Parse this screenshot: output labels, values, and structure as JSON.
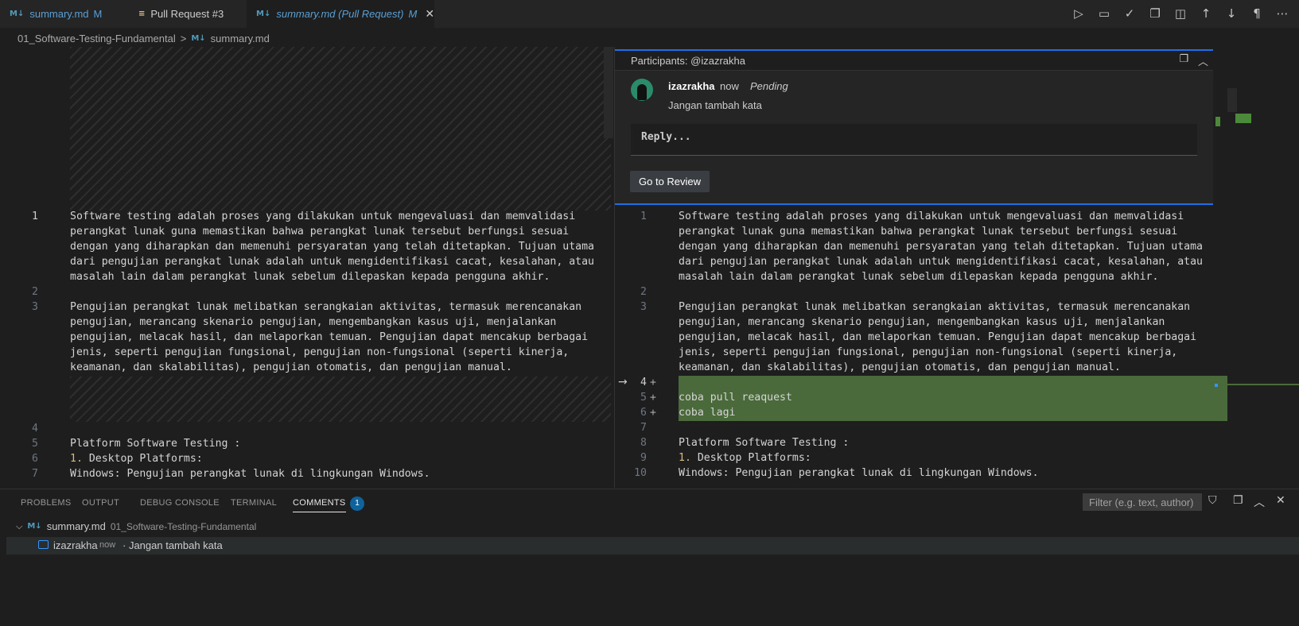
{
  "tabs": [
    {
      "label": "summary.md",
      "badge": "M",
      "icon": "markdown-icon"
    },
    {
      "label": "Pull Request #3",
      "badge": "",
      "icon": "pull-request-icon"
    },
    {
      "label": "summary.md (Pull Request)",
      "badge": "M",
      "icon": "markdown-icon",
      "close": "✕"
    }
  ],
  "editor_actions": [
    "run-icon",
    "comment-icon",
    "check-icon",
    "open-file-icon",
    "split-icon",
    "arrow-up-icon",
    "arrow-down-icon",
    "pilcrow-icon",
    "more-icon"
  ],
  "breadcrumb": {
    "folder": "01_Software-Testing-Fundamental",
    "separator": ">",
    "file": "summary.md"
  },
  "left": {
    "lines": [
      {
        "n": "1",
        "text": "Software testing adalah proses yang dilakukan untuk mengevaluasi dan memvalidasi"
      },
      {
        "n": "",
        "text": "perangkat lunak guna memastikan bahwa perangkat lunak tersebut berfungsi sesuai"
      },
      {
        "n": "",
        "text": "dengan yang diharapkan dan memenuhi persyaratan yang telah ditetapkan. Tujuan utama"
      },
      {
        "n": "",
        "text": "dari pengujian perangkat lunak adalah untuk mengidentifikasi cacat, kesalahan, atau"
      },
      {
        "n": "",
        "text": "masalah lain dalam perangkat lunak sebelum dilepaskan kepada pengguna akhir."
      },
      {
        "n": "2",
        "text": ""
      },
      {
        "n": "3",
        "text": "Pengujian perangkat lunak melibatkan serangkaian aktivitas, termasuk merencanakan"
      },
      {
        "n": "",
        "text": "pengujian, merancang skenario pengujian, mengembangkan kasus uji, menjalankan"
      },
      {
        "n": "",
        "text": "pengujian, melacak hasil, dan melaporkan temuan. Pengujian dapat mencakup berbagai"
      },
      {
        "n": "",
        "text": "jenis, seperti pengujian fungsional, pengujian non-fungsional (seperti kinerja,"
      },
      {
        "n": "",
        "text": "keamanan, dan skalabilitas), pengujian otomatis, dan pengujian manual."
      },
      {
        "n": "4",
        "text": ""
      },
      {
        "n": "5",
        "text": "Platform Software Testing :"
      },
      {
        "n": "6",
        "text": "1. Desktop Platforms:",
        "num": "1."
      },
      {
        "n": "7",
        "text": "Windows: Pengujian perangkat lunak di lingkungan Windows."
      }
    ]
  },
  "right": {
    "lines": [
      {
        "n": "1",
        "text": "Software testing adalah proses yang dilakukan untuk mengevaluasi dan memvalidasi"
      },
      {
        "n": "",
        "text": "perangkat lunak guna memastikan bahwa perangkat lunak tersebut berfungsi sesuai"
      },
      {
        "n": "",
        "text": "dengan yang diharapkan dan memenuhi persyaratan yang telah ditetapkan. Tujuan utama"
      },
      {
        "n": "",
        "text": "dari pengujian perangkat lunak adalah untuk mengidentifikasi cacat, kesalahan, atau"
      },
      {
        "n": "",
        "text": "masalah lain dalam perangkat lunak sebelum dilepaskan kepada pengguna akhir."
      },
      {
        "n": "2",
        "text": ""
      },
      {
        "n": "3",
        "text": "Pengujian perangkat lunak melibatkan serangkaian aktivitas, termasuk merencanakan"
      },
      {
        "n": "",
        "text": "pengujian, merancang skenario pengujian, mengembangkan kasus uji, menjalankan"
      },
      {
        "n": "",
        "text": "pengujian, melacak hasil, dan melaporkan temuan. Pengujian dapat mencakup berbagai"
      },
      {
        "n": "",
        "text": "jenis, seperti pengujian fungsional, pengujian non-fungsional (seperti kinerja,"
      },
      {
        "n": "",
        "text": "keamanan, dan skalabilitas), pengujian otomatis, dan pengujian manual."
      },
      {
        "n": "4",
        "text": "",
        "added": true
      },
      {
        "n": "5",
        "text": "coba pull reaquest",
        "added": true
      },
      {
        "n": "6",
        "text": "coba lagi",
        "added": true
      },
      {
        "n": "7",
        "text": ""
      },
      {
        "n": "8",
        "text": "Platform Software Testing :"
      },
      {
        "n": "9",
        "text": "1. Desktop Platforms:",
        "num": "1."
      },
      {
        "n": "10",
        "text": "Windows: Pengujian perangkat lunak di lingkungan Windows."
      }
    ]
  },
  "comment_widget": {
    "participants": "Participants: @izazrakha",
    "author": "izazrakha",
    "time": "now",
    "status": "Pending",
    "body": "Jangan tambah kata",
    "reply_placeholder": "Reply...",
    "go_review": "Go to Review"
  },
  "panel": {
    "tabs": [
      "PROBLEMS",
      "OUTPUT",
      "DEBUG CONSOLE",
      "TERMINAL",
      "COMMENTS"
    ],
    "comments_count": "1",
    "filter_placeholder": "Filter (e.g. text, author)",
    "file": {
      "name": "summary.md",
      "path": "01_Software-Testing-Fundamental"
    },
    "comment": {
      "author": "izazrakha",
      "time": "now",
      "text": "· Jangan tambah kata"
    }
  },
  "colors": {
    "accent": "#1f6feb",
    "added_line": "#4b6a3b",
    "markdown_icon": "#519aba"
  }
}
